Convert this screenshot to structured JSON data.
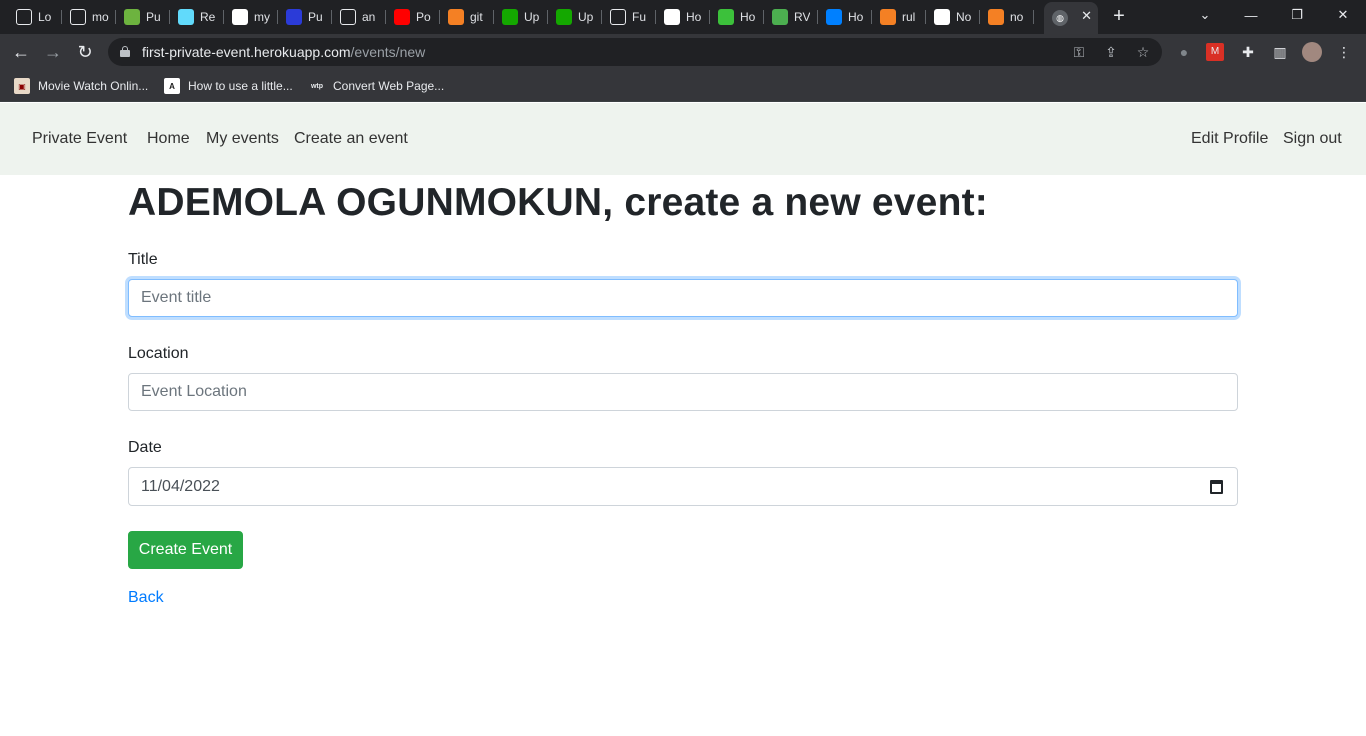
{
  "browser": {
    "tabs": [
      {
        "title": "Lo",
        "icon": "generic-tab-icon",
        "color": "#202124"
      },
      {
        "title": "mo",
        "icon": "generic-tab-icon",
        "color": "#202124"
      },
      {
        "title": "Pu",
        "icon": "leaf-icon",
        "color": "#6db33f"
      },
      {
        "title": "Re",
        "icon": "react-icon",
        "color": "#61dafb"
      },
      {
        "title": "my",
        "icon": "google-icon",
        "color": "#ffffff"
      },
      {
        "title": "Pu",
        "icon": "bootstrap-icon",
        "color": "#2b3bd8"
      },
      {
        "title": "an",
        "icon": "generic-tab-icon",
        "color": "#202124"
      },
      {
        "title": "Po",
        "icon": "youtube-icon",
        "color": "#ff0000"
      },
      {
        "title": "git",
        "icon": "stackoverflow-icon",
        "color": "#f48024"
      },
      {
        "title": "Up",
        "icon": "upwork-icon",
        "color": "#14a800"
      },
      {
        "title": "Up",
        "icon": "upwork-icon",
        "color": "#14a800"
      },
      {
        "title": "Fu",
        "icon": "generic-tab-icon",
        "color": "#202124"
      },
      {
        "title": "Ho",
        "icon": "hackernoon-icon",
        "color": "#ffffff"
      },
      {
        "title": "Ho",
        "icon": "typescript-icon",
        "color": "#3cc13b"
      },
      {
        "title": "RV",
        "icon": "rvm-icon",
        "color": "#4caf50"
      },
      {
        "title": "Ho",
        "icon": "digitalocean-icon",
        "color": "#0080ff"
      },
      {
        "title": "rul",
        "icon": "stackoverflow-icon",
        "color": "#f48024"
      },
      {
        "title": "No",
        "icon": "github-icon",
        "color": "#ffffff"
      },
      {
        "title": "no",
        "icon": "stackoverflow-icon",
        "color": "#f48024"
      }
    ],
    "active_tab_icon": "globe-icon",
    "url_host": "first-private-event.herokuapp.com",
    "url_path": "/events/new",
    "bookmarks": [
      {
        "label": "Movie Watch Onlin...",
        "icon": "movie-icon"
      },
      {
        "label": "How to use a little...",
        "icon": "angular-icon"
      },
      {
        "label": "Convert Web Page...",
        "icon": "wtp-icon"
      }
    ]
  },
  "navbar": {
    "brand": "Private Event",
    "links": [
      "Home",
      "My events",
      "Create an event"
    ],
    "right_links": [
      "Edit Profile",
      "Sign out"
    ]
  },
  "form": {
    "heading": "ADEMOLA OGUNMOKUN, create a new event:",
    "title_label": "Title",
    "title_placeholder": "Event title",
    "location_label": "Location",
    "location_placeholder": "Event Location",
    "date_label": "Date",
    "date_value": "11/04/2022",
    "submit_label": "Create Event",
    "back_label": "Back"
  },
  "colors": {
    "navbar_bg": "#eef3ee",
    "submit_bg": "#28a745",
    "link": "#007bff"
  }
}
